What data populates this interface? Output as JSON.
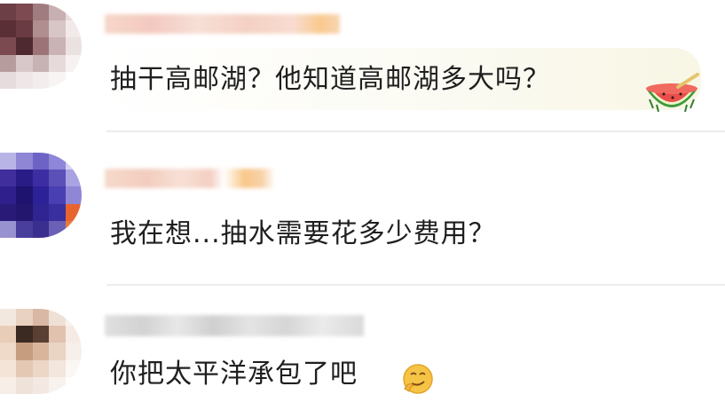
{
  "comments": [
    {
      "username_hidden": true,
      "text": "抽干高邮湖？他知道高邮湖多大吗？",
      "emoji": "watermelon-emoji"
    },
    {
      "username_hidden": true,
      "text": "我在想...抽水需要花多少费用？",
      "emoji": null
    },
    {
      "username_hidden": true,
      "text": "你把太平洋承包了吧",
      "emoji": "smug-face-emoji"
    }
  ],
  "colors": {
    "text": "#1f1f1f",
    "divider": "#ececec",
    "name_highlight": "#f5b56a"
  }
}
